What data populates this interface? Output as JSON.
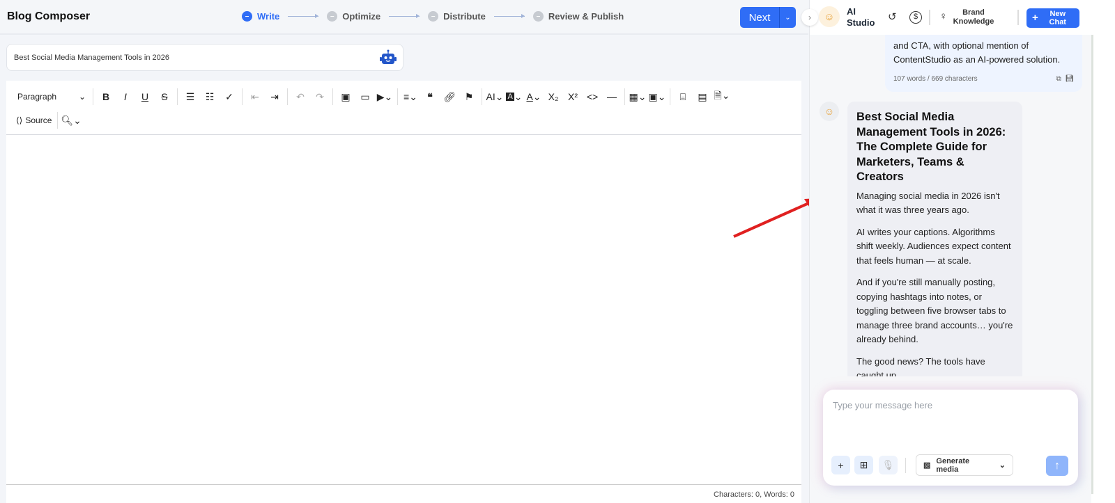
{
  "app": {
    "title": "Blog Composer"
  },
  "steps": [
    {
      "label": "Write",
      "active": true
    },
    {
      "label": "Optimize"
    },
    {
      "label": "Distribute"
    },
    {
      "label": "Review & Publish"
    }
  ],
  "next_label": "Next",
  "post_title": "Best Social Media Management Tools in 2026",
  "toolbar": {
    "paragraph": "Paragraph",
    "source": "Source",
    "superscript": "X²",
    "subscript": "X₂"
  },
  "footer": "Characters: 0, Words: 0",
  "panel": {
    "title": "AI Studio",
    "brand_knowledge": "Brand Knowledge",
    "new_chat": "New Chat",
    "user_msg": "and CTA, with optional mention of ContentStudio as an AI-powered solution.",
    "user_meta": "107 words / 669 characters",
    "ai_title": "Best Social Media Management Tools in 2026: The Complete Guide for Marketers, Teams & Creators",
    "ai_paragraphs": [
      "Managing social media in 2026 isn't what it was three years ago.",
      "AI writes your captions. Algorithms shift weekly. Audiences expect content that feels human — at scale.",
      "And if you're still manually posting, copying hashtags into notes, or toggling between five browser tabs to manage three brand accounts… you're already behind.",
      "The good news? The tools have caught up."
    ],
    "input_placeholder": "Type your message here",
    "generate_media": "Generate media"
  },
  "colors": {
    "accent": "#2f6df6",
    "annotation": "#e02020"
  }
}
